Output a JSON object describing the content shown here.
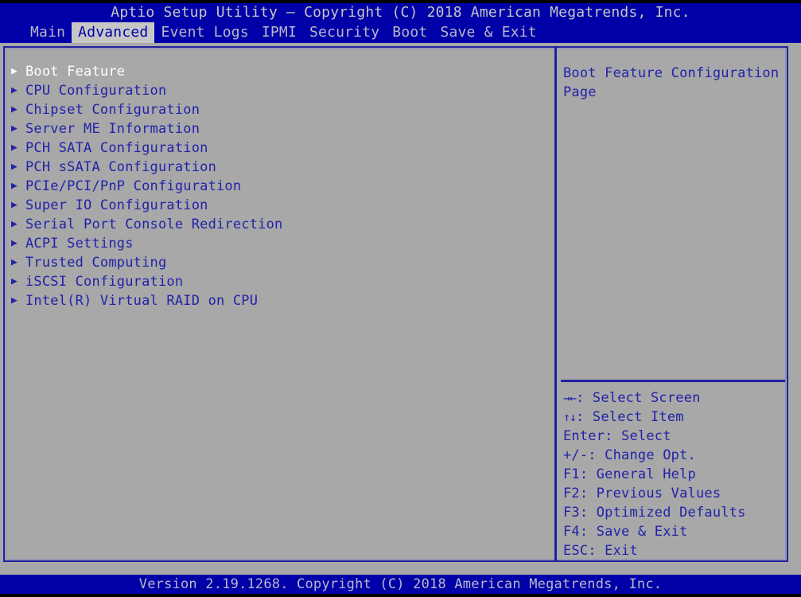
{
  "title": "Aptio Setup Utility – Copyright (C) 2018 American Megatrends, Inc.",
  "menubar": {
    "tabs": [
      {
        "label": "Main",
        "active": false
      },
      {
        "label": "Advanced",
        "active": true
      },
      {
        "label": "Event Logs",
        "active": false
      },
      {
        "label": "IPMI",
        "active": false
      },
      {
        "label": "Security",
        "active": false
      },
      {
        "label": "Boot",
        "active": false
      },
      {
        "label": "Save & Exit",
        "active": false
      }
    ]
  },
  "left_panel": {
    "items": [
      {
        "label": "Boot Feature",
        "selected": true
      },
      {
        "label": "CPU Configuration",
        "selected": false
      },
      {
        "label": "Chipset Configuration",
        "selected": false
      },
      {
        "label": "Server ME Information",
        "selected": false
      },
      {
        "label": "PCH SATA Configuration",
        "selected": false
      },
      {
        "label": "PCH sSATA Configuration",
        "selected": false
      },
      {
        "label": "PCIe/PCI/PnP Configuration",
        "selected": false
      },
      {
        "label": "Super IO Configuration",
        "selected": false
      },
      {
        "label": "Serial Port Console Redirection",
        "selected": false
      },
      {
        "label": "ACPI Settings",
        "selected": false
      },
      {
        "label": "Trusted Computing",
        "selected": false
      },
      {
        "label": "iSCSI Configuration",
        "selected": false
      },
      {
        "label": "Intel(R) Virtual RAID on CPU",
        "selected": false
      }
    ]
  },
  "right_panel": {
    "help": "Boot Feature Configuration Page",
    "keys": [
      {
        "glyph": "→←",
        "text": ": Select Screen"
      },
      {
        "glyph": "↑↓",
        "text": ": Select Item"
      },
      {
        "glyph": "",
        "text": "Enter: Select"
      },
      {
        "glyph": "",
        "text": "+/-: Change Opt."
      },
      {
        "glyph": "",
        "text": "F1: General Help"
      },
      {
        "glyph": "",
        "text": "F2: Previous Values"
      },
      {
        "glyph": "",
        "text": "F3: Optimized Defaults"
      },
      {
        "glyph": "",
        "text": "F4: Save & Exit"
      },
      {
        "glyph": "",
        "text": "ESC: Exit"
      }
    ]
  },
  "footer": "Version 2.19.1268. Copyright (C) 2018 American Megatrends, Inc.",
  "colors": {
    "bar_blue": "#0000a8",
    "panel_gray": "#a8a8a8",
    "text_blue": "#2222aa",
    "text_light": "#b8b8c8",
    "selected_white": "#ffffff",
    "border_blue": "#2020a0"
  },
  "icons": {
    "submenu_arrow": "submenu-triangle-icon"
  }
}
